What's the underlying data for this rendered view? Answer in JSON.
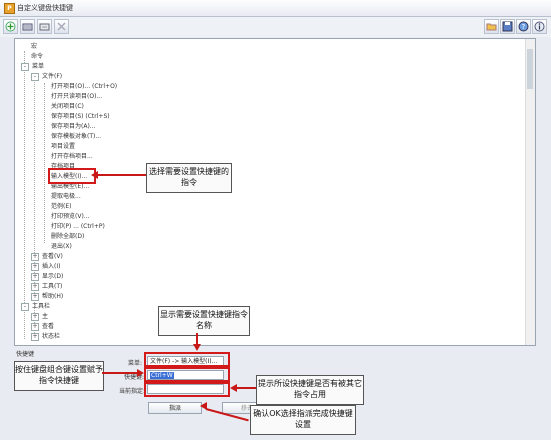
{
  "window": {
    "title": "自定义键盘快捷键",
    "app_icon_letter": "P"
  },
  "toolbar": {
    "left_icons": [
      "add-icon",
      "keyboard-add-icon",
      "edit-icon",
      "delete-icon"
    ],
    "right_icons": [
      "open-folder-icon",
      "save-icon",
      "help-icon",
      "info-icon"
    ]
  },
  "tree": {
    "items": [
      {
        "label": "宏",
        "level": 0
      },
      {
        "label": "命令",
        "level": 0
      },
      {
        "label": "菜单",
        "level": 0,
        "toggle": "-"
      },
      {
        "label": "文件(F)",
        "level": 1,
        "toggle": "-"
      },
      {
        "label": "打开项目(O)... (Ctrl+O)",
        "level": 2
      },
      {
        "label": "打开只读项目(O)...",
        "level": 2
      },
      {
        "label": "关闭项目(C)",
        "level": 2
      },
      {
        "label": "保存项目(S) (Ctrl+S)",
        "level": 2
      },
      {
        "label": "保存项目为(A)...",
        "level": 2
      },
      {
        "label": "保存模板对象(T)...",
        "level": 2
      },
      {
        "label": "项目设置",
        "level": 2
      },
      {
        "label": "打开存档项目...",
        "level": 2
      },
      {
        "label": "存档项目",
        "level": 2
      },
      {
        "label": "输入模型(I)...",
        "level": 2
      },
      {
        "label": "输出模型(E)...",
        "level": 2
      },
      {
        "label": "提取电极...",
        "level": 2
      },
      {
        "label": "范例(E)",
        "level": 2
      },
      {
        "label": "打印预览(V)...",
        "level": 2
      },
      {
        "label": "打印(P) ... (Ctrl+P)",
        "level": 2
      },
      {
        "label": "删除全部(D)",
        "level": 2
      },
      {
        "label": "退出(X)",
        "level": 2
      },
      {
        "label": "查看(V)",
        "level": 1,
        "toggle": "+"
      },
      {
        "label": "插入(I)",
        "level": 1,
        "toggle": "+"
      },
      {
        "label": "显示(D)",
        "level": 1,
        "toggle": "+"
      },
      {
        "label": "工具(T)",
        "level": 1,
        "toggle": "+"
      },
      {
        "label": "帮助(H)",
        "level": 1,
        "toggle": "+"
      },
      {
        "label": "工具栏",
        "level": 0,
        "toggle": "-"
      },
      {
        "label": "主",
        "level": 1,
        "toggle": "+"
      },
      {
        "label": "查看",
        "level": 1,
        "toggle": "+"
      },
      {
        "label": "状态栏",
        "level": 1,
        "toggle": "+"
      }
    ]
  },
  "shortcut": {
    "group_label": "快捷键",
    "menu_label": "菜单:",
    "menu_value": "文件(F) -> 输入模型(I)...",
    "shortcut_label": "快捷键:",
    "shortcut_value": "Ctrl+W",
    "current_label": "当前指定:",
    "current_value": "",
    "assign_button": "指派",
    "remove_button": "移去"
  },
  "callouts": {
    "select_command": "选择需要设置快捷键的指令",
    "show_name": "显示需要设置快捷键指令名称",
    "press_keys": "按住键盘组合键设置赋予指令快捷键",
    "hint_used": "提示所设快捷键是否有被其它指令占用",
    "confirm": "确认OK选择指派完成快捷键设置"
  },
  "colors": {
    "annotation_red": "#d21a1a",
    "selection_blue": "#3b6fd6"
  }
}
